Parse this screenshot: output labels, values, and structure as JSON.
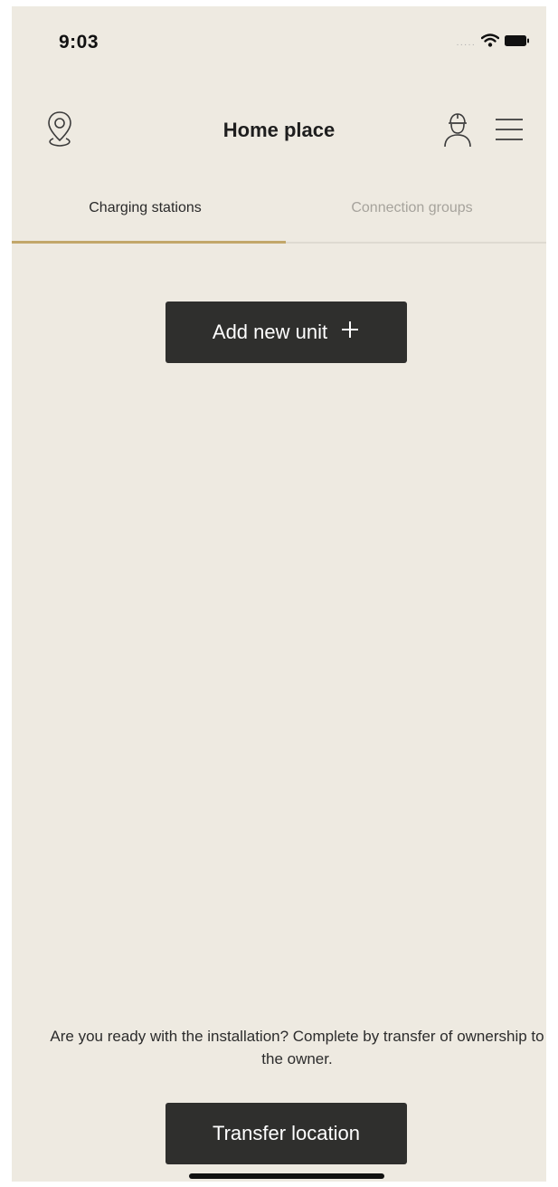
{
  "status_bar": {
    "time": "9:03",
    "icons": [
      "signal-dots-icon",
      "wifi-icon",
      "battery-icon"
    ]
  },
  "header": {
    "title": "Home place",
    "left_icon": "location-pin-icon",
    "right_icons": [
      "installer-profile-icon",
      "menu-icon"
    ]
  },
  "tabs": [
    {
      "label": "Charging stations",
      "active": true
    },
    {
      "label": "Connection groups",
      "active": false
    }
  ],
  "actions": {
    "add_unit_label": "Add new unit",
    "transfer_label": "Transfer location"
  },
  "footer": {
    "info_text": "Are you ready with the installation? Complete by transfer of ownership to the owner."
  },
  "colors": {
    "background": "#eeeae1",
    "button": "#2f2f2d",
    "accent": "#c2a76a"
  }
}
